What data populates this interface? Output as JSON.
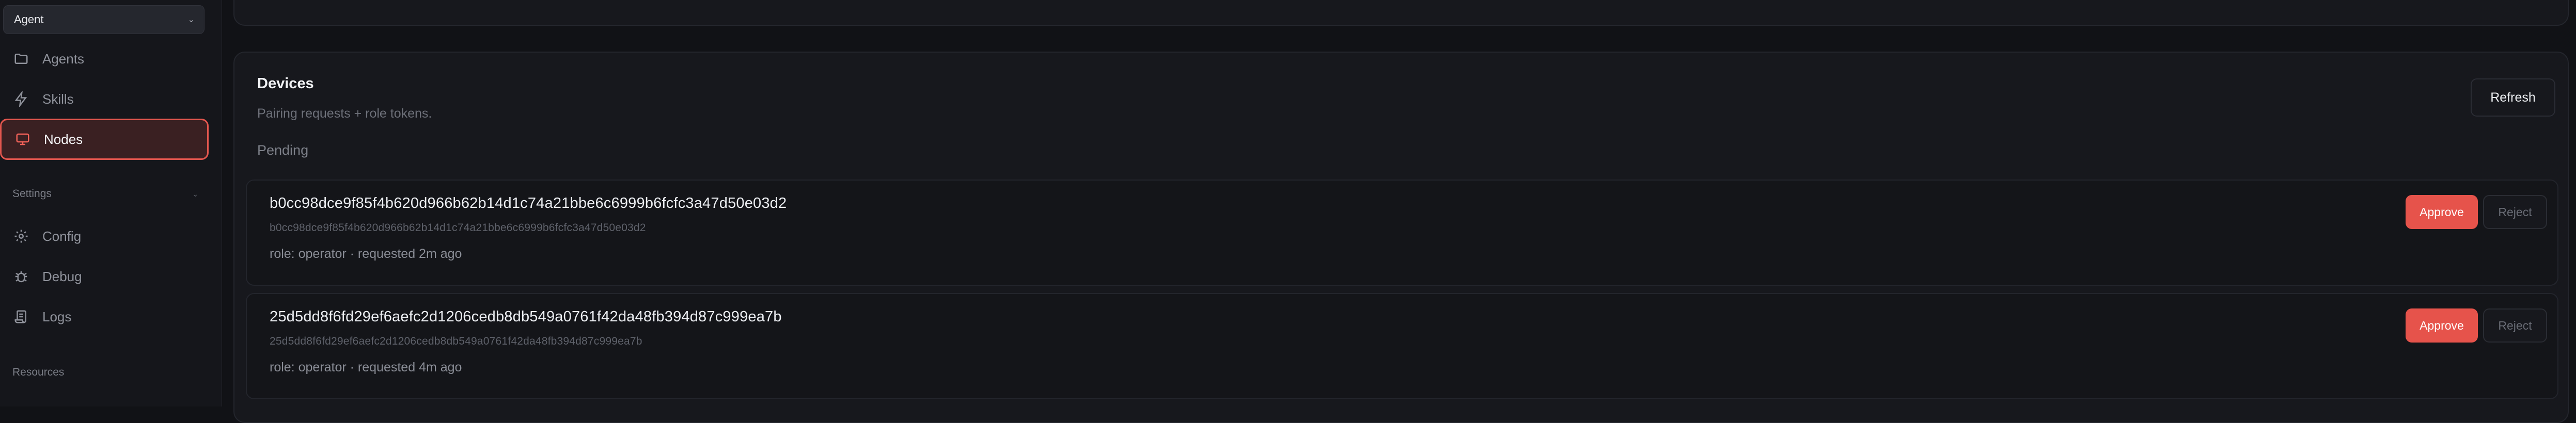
{
  "sidebar": {
    "agent_select": {
      "value": "Agent"
    },
    "items_top": [
      {
        "label": "Agents",
        "icon": "folder-icon"
      },
      {
        "label": "Skills",
        "icon": "lightning-icon"
      },
      {
        "label": "Nodes",
        "icon": "monitor-icon",
        "active": true
      }
    ],
    "settings_section": {
      "label": "Settings"
    },
    "items_settings": [
      {
        "label": "Config",
        "icon": "gear-icon"
      },
      {
        "label": "Debug",
        "icon": "bug-icon"
      },
      {
        "label": "Logs",
        "icon": "scroll-icon"
      }
    ],
    "resources_section": {
      "label": "Resources"
    }
  },
  "devices": {
    "title": "Devices",
    "subtitle": "Pairing requests + role tokens.",
    "refresh_label": "Refresh",
    "pending_label": "Pending",
    "requests": [
      {
        "title": "b0cc98dce9f85f4b620d966b62b14d1c74a21bbe6c6999b6fcfc3a47d50e03d2",
        "id": "b0cc98dce9f85f4b620d966b62b14d1c74a21bbe6c6999b6fcfc3a47d50e03d2",
        "meta": "role: operator · requested 2m ago",
        "approve_label": "Approve",
        "reject_label": "Reject"
      },
      {
        "title": "25d5dd8f6fd29ef6aefc2d1206cedb8db549a0761f42da48fb394d87c999ea7b",
        "id": "25d5dd8f6fd29ef6aefc2d1206cedb8db549a0761f42da48fb394d87c999ea7b",
        "meta": "role: operator · requested 4m ago",
        "approve_label": "Approve",
        "reject_label": "Reject"
      }
    ]
  },
  "colors": {
    "accent": "#e6534b",
    "background": "#111216",
    "card": "#17181d"
  }
}
